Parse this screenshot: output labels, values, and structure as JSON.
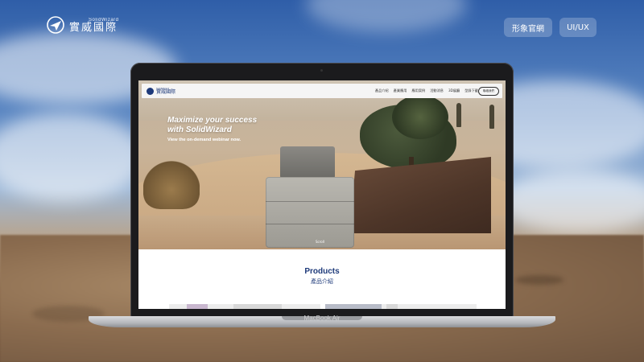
{
  "brand": {
    "en": "SolidWizard",
    "zh": "實威國際"
  },
  "top_links": [
    {
      "label": "形象官網"
    },
    {
      "label": "UI/UX"
    }
  ],
  "device": {
    "model": "MacBook Air"
  },
  "website": {
    "logo": {
      "en": "SolidWizard",
      "zh": "實威國際"
    },
    "menu": [
      "產品介紹",
      "產業應用",
      "應用案例",
      "活動消息",
      "3D展廳",
      "型錄下載"
    ],
    "login_label": "聯絡我們",
    "hero": {
      "title_line1": "Maximize your success",
      "title_line2": "with SolidWizard",
      "subtitle": "View the on-demand webinar now.",
      "scroll": "Scroll"
    },
    "products": {
      "title": "Products",
      "subtitle": "產品介紹"
    }
  },
  "colors": {
    "brand_navy": "#1e3a7a"
  }
}
